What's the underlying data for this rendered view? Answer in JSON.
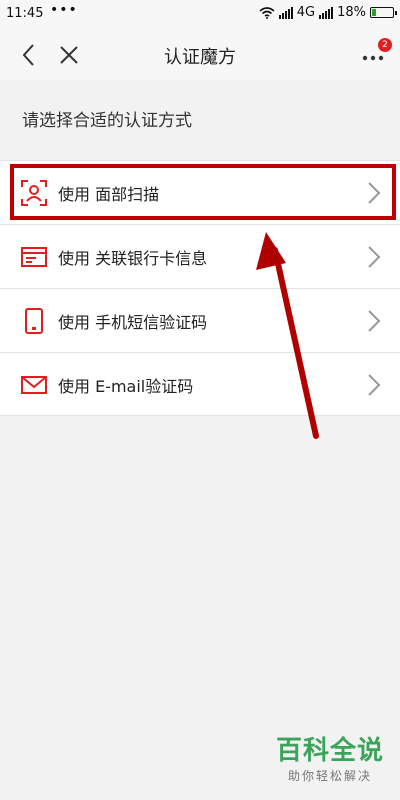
{
  "statusbar": {
    "time": "11:45",
    "dots": "•••",
    "network": "4G",
    "battery": "18%"
  },
  "navbar": {
    "title": "认证魔方",
    "badge_count": "2"
  },
  "prompt": "请选择合适的认证方式",
  "options": [
    {
      "label": "使用 面部扫描",
      "icon": "face-scan-icon"
    },
    {
      "label": "使用 关联银行卡信息",
      "icon": "bank-card-icon"
    },
    {
      "label": "使用 手机短信验证码",
      "icon": "phone-icon"
    },
    {
      "label": "使用 E-mail验证码",
      "icon": "mail-icon"
    }
  ],
  "colors": {
    "accent": "#e02020",
    "annotation": "#c00000",
    "watermark": "#3aa55a"
  },
  "watermark": {
    "title": "百科全说",
    "subtitle": "助你轻松解决"
  }
}
